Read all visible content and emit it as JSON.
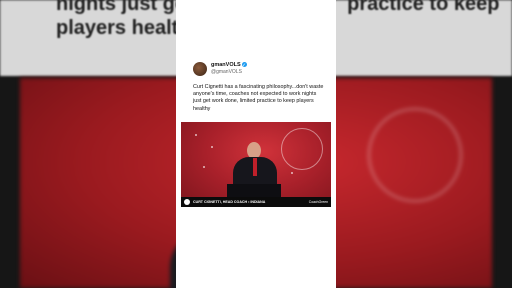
{
  "background": {
    "headline_line1": "nights just get w",
    "headline_line1_rest": "practice to keep",
    "headline_line2": "players healthy"
  },
  "tweet": {
    "display_name": "gmanVOLS",
    "handle": "@gmanVOLS",
    "text": "Curt Cignetti has a fascinating philosophy...don't waste anyone's time, coaches not expected to work nights just get work done, limited practice to keep players healthy",
    "verified": true
  },
  "video": {
    "caption": "CURT CIGNETTI, HEAD COACH • INDIANA",
    "brand": "CoachGreen"
  },
  "colors": {
    "backdrop_red": "#c8282e",
    "verified_blue": "#1d9bf0",
    "card_bg": "#ffffff"
  }
}
